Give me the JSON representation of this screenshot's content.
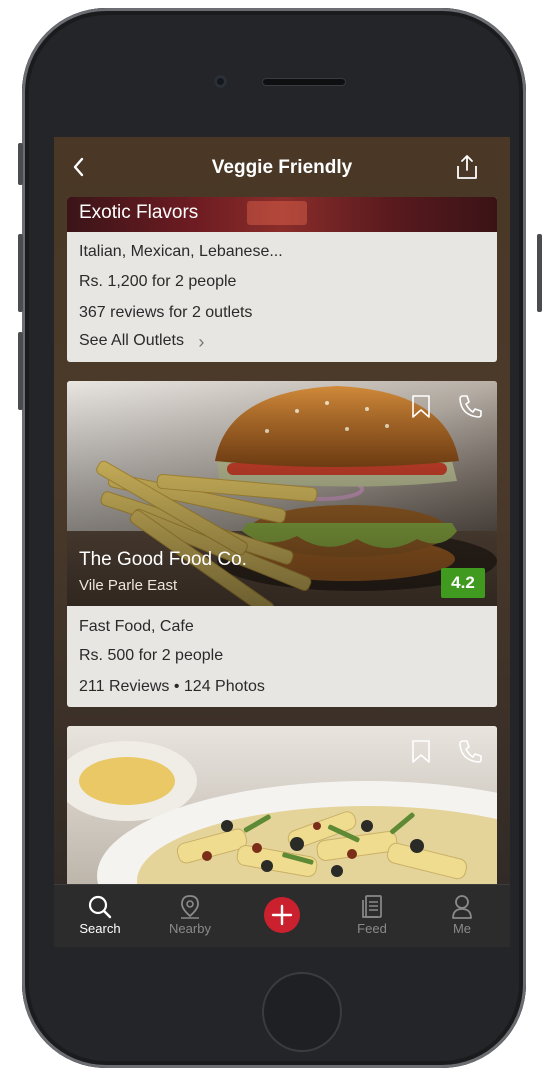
{
  "header": {
    "title": "Veggie Friendly"
  },
  "cards": [
    {
      "name": "Exotic Flavors",
      "cuisines": "Italian, Mexican, Lebanese...",
      "cost": "Rs. 1,200 for 2 people",
      "reviews": "367 reviews for 2 outlets",
      "see_all": "See All Outlets",
      "see_all_chevron": "›"
    },
    {
      "name": "The Good Food Co.",
      "location": "Vile Parle East",
      "rating": "4.2",
      "cuisines": "Fast Food, Cafe",
      "cost": "Rs. 500 for 2 people",
      "reviews": "211 Reviews • 124 Photos"
    },
    {
      "name": "",
      "image": "pasta-dish"
    }
  ],
  "tabbar": {
    "items": [
      {
        "label": "Search",
        "icon": "search-icon"
      },
      {
        "label": "Nearby",
        "icon": "location-pin-icon"
      },
      {
        "label": "",
        "icon": "add-icon"
      },
      {
        "label": "Feed",
        "icon": "feed-icon"
      },
      {
        "label": "Me",
        "icon": "profile-icon"
      }
    ]
  },
  "colors": {
    "accent_red": "#cb202d",
    "rating_green": "#3f9a1f",
    "tabbar_bg": "#2c2c2c",
    "card_bg": "#e8e6e3"
  }
}
